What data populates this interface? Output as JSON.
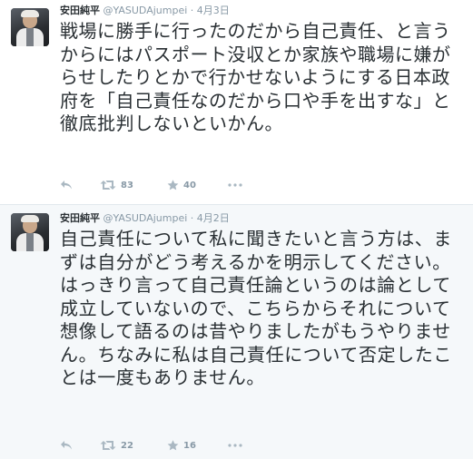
{
  "tweets": [
    {
      "name": "安田純平",
      "handle": "@YASUDAjumpei",
      "separator": "·",
      "date": "4月3日",
      "text": "戦場に勝手に行ったのだから自己責任、と言うからにはパスポート没収とか家族や職場に嫌がらせしたりとかで行かせないようにする日本政府を「自己責任なのだから口や手を出すな」と徹底批判しないといかん。",
      "retweets": "83",
      "favorites": "40"
    },
    {
      "name": "安田純平",
      "handle": "@YASUDAjumpei",
      "separator": "·",
      "date": "4月2日",
      "text": "自己責任について私に聞きたいと言う方は、まずは自分がどう考えるかを明示してください。はっきり言って自己責任論というのは論として成立していないので、こちらからそれについて想像して語るのは昔やりましたがもうやりません。ちなみに私は自己責任について否定したことは一度もありません。",
      "retweets": "22",
      "favorites": "16"
    }
  ],
  "icons": {
    "reply": "reply-icon",
    "retweet": "retweet-icon",
    "favorite": "star-icon",
    "more": "more-icon"
  },
  "colors": {
    "text": "#292f33",
    "muted": "#8899a6",
    "border": "#e1e8ed",
    "highlight_bg": "#f5f8fa"
  }
}
